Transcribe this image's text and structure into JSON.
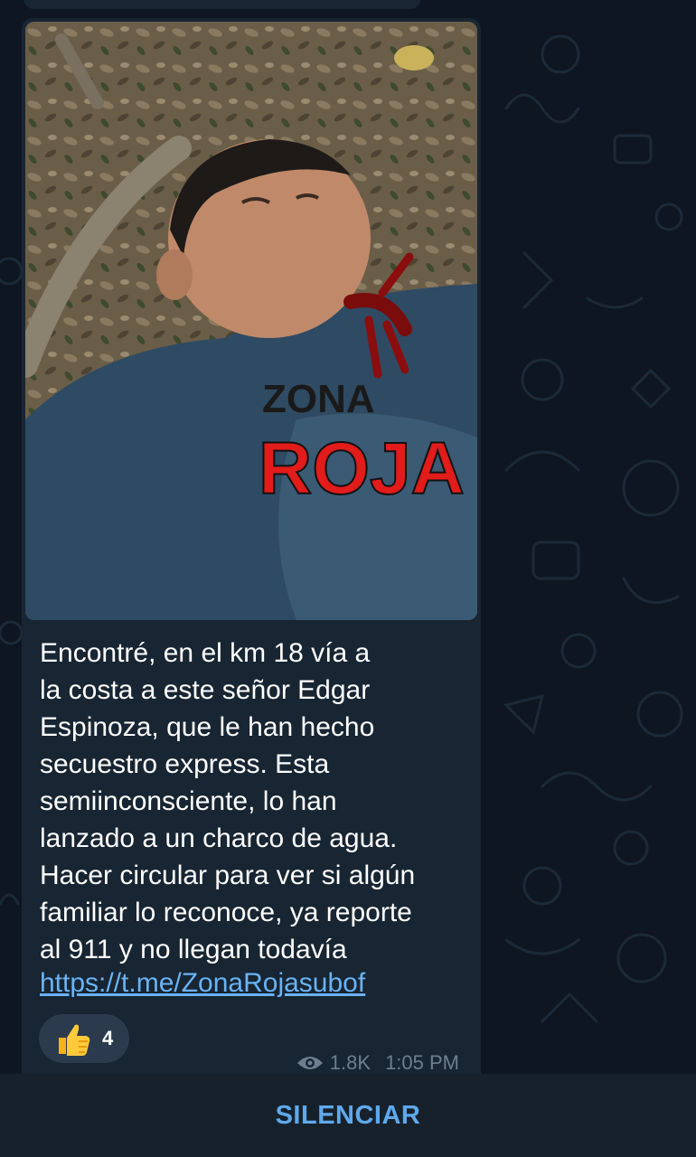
{
  "message": {
    "text": "Encontré, en el km 18 vía a\nla costa a este señor Edgar\nEspinoza, que le han hecho\nsecuestro express. Esta\nsemiinconsciente, lo han\nlanzado a un charco de agua.\nHacer circular para ver si algún\nfamiliar lo reconoce, ya reporte\nal 911 y no llegan todavía",
    "link": "https://t.me/ZonaRojasubof",
    "photo_watermark": {
      "line1": "ZONA",
      "line2": "ROJA"
    },
    "reaction": {
      "emoji": "thumbs-up-icon",
      "count": "4"
    },
    "views": "1.8K",
    "time": "1:05 PM"
  },
  "bottom_bar": {
    "mute_label": "SILENCIAR"
  },
  "colors": {
    "background": "#0e1621",
    "bubble": "#182533",
    "link": "#6ab3f3",
    "meta": "#6d7f8f",
    "bottom_bar": "#17212b",
    "mute_text": "#5fa9eb",
    "watermark_red": "#e21b1b"
  }
}
